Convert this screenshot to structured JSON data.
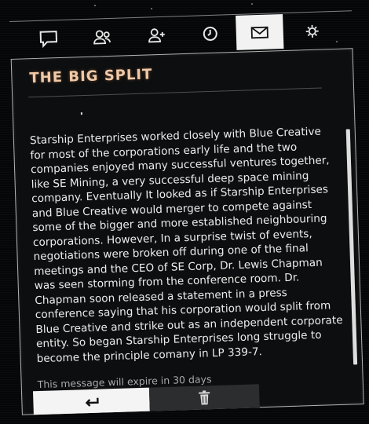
{
  "tabs": [
    {
      "id": "chat",
      "icon": "chat-bubble-icon",
      "active": false
    },
    {
      "id": "friends",
      "icon": "users-icon",
      "active": false
    },
    {
      "id": "add-friend",
      "icon": "add-user-icon",
      "active": false
    },
    {
      "id": "history",
      "icon": "clock-icon",
      "active": false
    },
    {
      "id": "inbox",
      "icon": "envelope-icon",
      "active": true
    },
    {
      "id": "settings",
      "icon": "settings-cog-icon",
      "active": false
    }
  ],
  "message": {
    "title": "THE BIG SPLIT",
    "body": "Starship Enterprises worked closely with Blue Creative for most of the corporations early life and the two companies enjoyed many successful ventures together, like SE Mining, a very successful deep space mining company. Eventually It looked as if Starship Enterprises and Blue Creative would merger to compete against some of the bigger and more established neighbouring corporations. However, In a surprise twist of events, negotiations were broken off during one of the final meetings and the CEO of SE Corp, Dr. Lewis Chapman was seen storming from the conference room. Dr. Chapman soon released a statement in a press conference saying that his corporation would split from Blue Creative and strike out as an independent corporate entity. So began Starship Enterprises long struggle to become the principle comany in LP 339-7.",
    "expiry": "This message will expire in 30 days"
  },
  "actions": {
    "back_icon": "back-arrow-icon",
    "delete_icon": "trash-icon"
  },
  "colors": {
    "title": "#f0c9a6",
    "active_tab_bg": "#f2f2f2",
    "panel_border": "#ebebeb",
    "background": "#050607"
  }
}
